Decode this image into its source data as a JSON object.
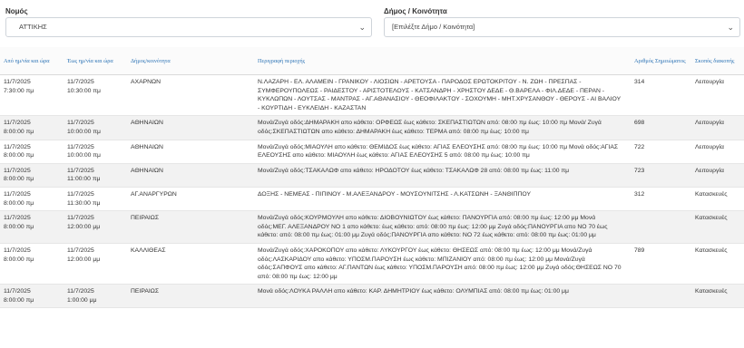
{
  "filters": {
    "nomos_label": "Νομός",
    "nomos_value": "ΑΤΤΙΚΗΣ",
    "dimos_label": "Δήμος / Κοινότητα",
    "dimos_value": "[Επιλέξτε Δήμο / Κοινότητα]"
  },
  "table": {
    "headers": [
      "Από ημ/νία και ώρα",
      "Έως ημ/νία και ώρα",
      "Δήμος/κοινότητα",
      "Περιγραφή περιοχής",
      "Αριθμός Σημειώματος",
      "Σκοπός διακοπής"
    ],
    "rows": [
      {
        "from_date": "11/7/2025",
        "from_time": "7:30:00 πμ",
        "to_date": "11/7/2025",
        "to_time": "10:30:00 πμ",
        "municipality": "ΑΧΑΡΝΩΝ",
        "description": "Ν.ΛΑΖΑΡΗ - ΕΛ. ΑΛΑΜΕΙΝ - ΓΡΑΝΙΚΟΥ - ΛΙΟΣΙΩΝ - ΑΡΕΤΟΥΣΑ - ΠΑΡΟΔΟΣ ΕΡΩΤΟΚΡΙΤΟΥ - Ν. ΖΩΗ - ΠΡΕΣΠΑΣ - ΣΥΜΦΕΡΟΥΠΟΛΕΩΣ - ΡΑΙΔΕΣΤΟΥ - ΑΡΙΣΤΟΤΕΛΟΥΣ - ΚΑΤΣΑΝΔΡΗ - ΧΡΗΣΤΟΥ ΔΕΔΕ - Θ.ΒΑΡΕΛΑ - ΦΙΛ.ΔΕΔΕ - ΠΕΡΑΝ - ΚΥΚΛΩΠΩΝ - ΛΟΥΤΣΑΣ - ΜΑΝΤΡΑΣ - ΑΓ.ΑΘΑΝΑΣΙΟΥ - ΘΕΟΦΙΛΑΚΤΟΥ - ΣΟΧΟΥΜΗ - ΜΗΤ.ΧΡΥΣΑΝΘΟΥ - ΘΕΡΟΥΣ - ΑΙ ΒΑΛΙΟΥ - ΚΟΥΡΤΙΔΗ - ΕΥΚΛΕΙΔΗ - ΚΑΖΑΣΤΑΝ",
        "note": "314",
        "purpose": "Λειτουργία"
      },
      {
        "from_date": "11/7/2025",
        "from_time": "8:00:00 πμ",
        "to_date": "11/7/2025",
        "to_time": "10:00:00 πμ",
        "municipality": "ΑΘΗΝΑΙΩΝ",
        "description": "Μονά/Ζυγά οδός:ΔΗΜΑΡΑΚΗ απο κάθετο: ΟΡΦΕΩΣ έως κάθετο: ΣΚΕΠΑΣΤΙΩΤΩΝ από: 08:00 πμ έως: 10:00 πμ Μονά/ Ζυγά οδός:ΣΚΕΠΑΣΤΙΩΤΩΝ απο κάθετο: ΔΗΜΑΡΑΚΗ έως κάθετο: ΤΕΡΜΑ από: 08:00 πμ έως: 10:00 πμ",
        "note": "698",
        "purpose": "Λειτουργία"
      },
      {
        "from_date": "11/7/2025",
        "from_time": "8:00:00 πμ",
        "to_date": "11/7/2025",
        "to_time": "10:00:00 πμ",
        "municipality": "ΑΘΗΝΑΙΩΝ",
        "description": "Μονά/Ζυγά οδός:ΜΙΑΟΥΛΗ απο κάθετο: ΘΕΜΙΔΟΣ έως κάθετο: ΑΓΙΑΣ ΕΛΕΟΥΣΗΣ από: 08:00 πμ έως: 10:00 πμ Μονά οδός:ΑΓΙΑΣ ΕΛΕΟΥΣΗΣ απο κάθετο: ΜΙΑΟΥΛΗ έως κάθετο: ΑΓΙΑΣ ΕΛΕΟΥΣΗΣ 5 από: 08:00 πμ έως: 10:00 πμ",
        "note": "722",
        "purpose": "Λειτουργία"
      },
      {
        "from_date": "11/7/2025",
        "from_time": "8:00:00 πμ",
        "to_date": "11/7/2025",
        "to_time": "11:00:00 πμ",
        "municipality": "ΑΘΗΝΑΙΩΝ",
        "description": "Μονά/Ζυγά οδός:ΤΣΑΚΑΛΩΦ απο κάθετο: ΗΡΟΔΟΤΟΥ έως κάθετο: ΤΣΑΚΑΛΩΦ 28 από: 08:00 πμ έως: 11:00 πμ",
        "note": "723",
        "purpose": "Λειτουργία"
      },
      {
        "from_date": "11/7/2025",
        "from_time": "8:00:00 πμ",
        "to_date": "11/7/2025",
        "to_time": "11:30:00 πμ",
        "municipality": "ΑΓ.ΑΝΑΡΓΥΡΩΝ",
        "description": "ΔΟΞΗΣ - ΝΕΜΕΑΣ - ΠΙΠΙΝΟΥ - Μ.ΑΛΕΞΑΝΔΡΟΥ - ΜΟΥΣΟΥΝΙΤΣΗΣ - Λ.ΚΑΤΣΩΝΗ - ΞΑΝΘΙΠΠΟΥ",
        "note": "312",
        "purpose": "Κατασκευές"
      },
      {
        "from_date": "11/7/2025",
        "from_time": "8:00:00 πμ",
        "to_date": "11/7/2025",
        "to_time": "12:00:00 μμ",
        "municipality": "ΠΕΙΡΑΙΩΣ",
        "description": "Μονά/Ζυγά οδός:ΚΟΥΡΜΟΥΛΗ απο κάθετο: ΔΙΟΒΟΥΝΙΩΤΟΥ έως κάθετο: ΠΑΝΟΥΡΓΙΑ από: 08:00 πμ έως: 12:00 μμ Μονά οδός:ΜΕΓ. ΑΛΕΞΑΝΔΡΟΥ ΝΟ 1 απο κάθετο: έως κάθετο: από: 08:00 πμ έως: 12:00 μμ Ζυγά οδός:ΠΑΝΟΥΡΓΙΑ απο ΝΟ 70 έως κάθετο: από: 08:00 πμ έως: 01:00 μμ Ζυγά οδός:ΠΑΝΟΥΡΓΙΑ απο κάθετο: ΝΟ 72 έως κάθετο: από: 08:00 πμ έως: 01:00 μμ",
        "note": "",
        "purpose": "Κατασκευές"
      },
      {
        "from_date": "11/7/2025",
        "from_time": "8:00:00 πμ",
        "to_date": "11/7/2025",
        "to_time": "12:00:00 μμ",
        "municipality": "ΚΑΛΛΙΘΕΑΣ",
        "description": "Μονά/Ζυγά οδός:ΧΑΡΟΚΟΠΟΥ απο κάθετο: ΛΥΚΟΥΡΓΟΥ έως κάθετο: ΘΗΣΕΩΣ από: 08:00 πμ έως: 12:00 μμ Μονά/Ζυγά οδός:ΛΑΣΚΑΡΙΔΟΥ απο κάθετο: ΥΠΟΣΜ.ΠΑΡΟΥΣΗ έως κάθετο: ΜΠΙΖΑΝΙΟΥ από: 08:00 πμ έως: 12:00 μμ Μονά/Ζυγά οδός:ΣΑΠΦΟΥΣ απο κάθετο: ΑΓ.ΠΑΝΤΩΝ έως κάθετο: ΥΠΟΣΜ.ΠΑΡΟΥΣΗ από: 08:00 πμ έως: 12:00 μμ Ζυγά οδός:ΘΗΣΕΩΣ ΝΟ 70 από: 08:00 πμ έως: 12:00 μμ",
        "note": "789",
        "purpose": "Κατασκευές"
      },
      {
        "from_date": "11/7/2025",
        "from_time": "8:00:00 πμ",
        "to_date": "11/7/2025",
        "to_time": "1:00:00 μμ",
        "municipality": "ΠΕΙΡΑΙΩΣ",
        "description": "Μονά οδός:ΛΟΥΚΑ ΡΑΛΛΗ απο κάθετο: ΚΑΡ. ΔΗΜΗΤΡΙΟΥ έως κάθετο: ΟΛΥΜΠΙΑΣ από: 08:00 πμ έως: 01:00 μμ",
        "note": "",
        "purpose": "Κατασκευές"
      }
    ]
  },
  "colors": {
    "header_text": "#2a72b5",
    "alt_row": "#f2f2f2"
  },
  "icons": {
    "select_chevron": "chevron-down-icon"
  }
}
